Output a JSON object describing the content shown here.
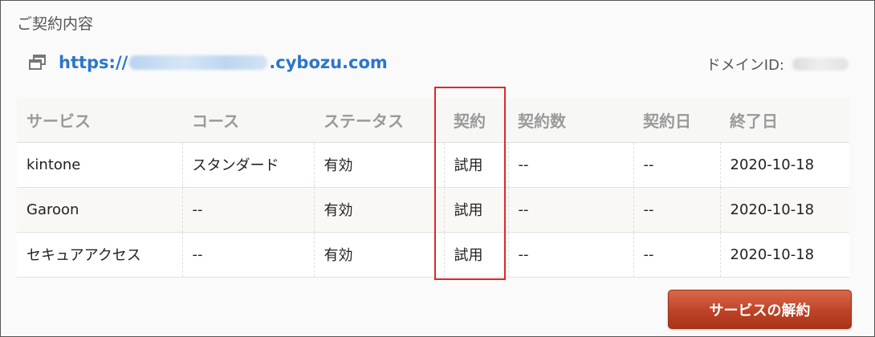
{
  "section": {
    "title": "ご契約内容"
  },
  "url": {
    "prefix": "https://",
    "suffix": ".cybozu.com"
  },
  "domain": {
    "label": "ドメインID:"
  },
  "table": {
    "headers": [
      "サービス",
      "コース",
      "ステータス",
      "契約",
      "契約数",
      "契約日",
      "終了日"
    ],
    "rows": [
      [
        "kintone",
        "スタンダード",
        "有効",
        "試用",
        "--",
        "--",
        "2020-10-18"
      ],
      [
        "Garoon",
        "--",
        "有効",
        "試用",
        "--",
        "--",
        "2020-10-18"
      ],
      [
        "セキュアアクセス",
        "--",
        "有効",
        "試用",
        "--",
        "--",
        "2020-10-18"
      ]
    ]
  },
  "actions": {
    "cancel_label": "サービスの解約"
  },
  "colors": {
    "link": "#2a77c9",
    "highlight": "#e0262b",
    "button": "#bd4328"
  }
}
